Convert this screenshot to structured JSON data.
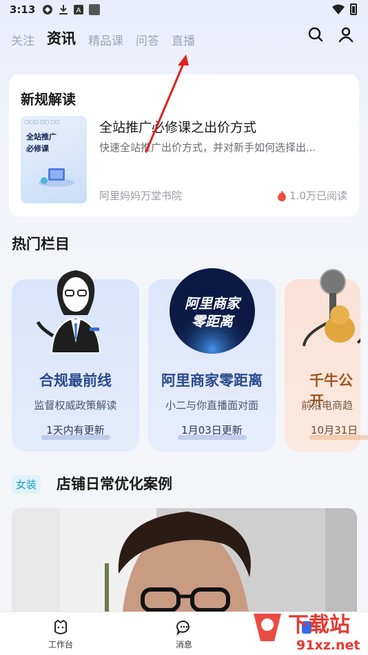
{
  "status_bar": {
    "time": "3:13"
  },
  "nav": {
    "tabs": [
      {
        "label": "关注"
      },
      {
        "label": "资讯",
        "active": true
      },
      {
        "label": "精品课"
      },
      {
        "label": "问答"
      },
      {
        "label": "直播"
      }
    ],
    "icons": [
      "search-icon",
      "user-icon"
    ]
  },
  "news": {
    "section_title": "新规解读",
    "thumb_text_line1": "全站推广",
    "thumb_text_line2": "必修课",
    "title": "全站推广必修课之出价方式",
    "description": "快速全站推广出价方式，并对新手如何选择出...",
    "source": "阿里妈妈万堂书院",
    "reads": "1.0万已阅读"
  },
  "hot_columns": {
    "title": "热门栏目",
    "items": [
      {
        "name": "合规最前线",
        "subtitle": "监督权威政策解读",
        "updated": "1天内有更新"
      },
      {
        "name": "阿里商家零距离",
        "subtitle": "小二与你直播面对面",
        "updated": "1月03日更新",
        "logo_text_line1": "阿里商家",
        "logo_text_line2": "零距离"
      },
      {
        "name": "千牛公开",
        "subtitle": "前沿电商趋",
        "updated": "10月31日"
      }
    ]
  },
  "cases": {
    "tag": "女装",
    "title": "店铺日常优化案例"
  },
  "tabbar": {
    "items": [
      {
        "label": "工作台",
        "icon": "workbench-icon"
      },
      {
        "label": "消息",
        "icon": "message-icon"
      }
    ]
  },
  "watermark": {
    "text_line1": "下载站",
    "text_line2": "91xz.net"
  },
  "colors": {
    "accent": "#2a4a8c",
    "background": "#f3f5f9",
    "annotation_arrow": "#e02020"
  }
}
